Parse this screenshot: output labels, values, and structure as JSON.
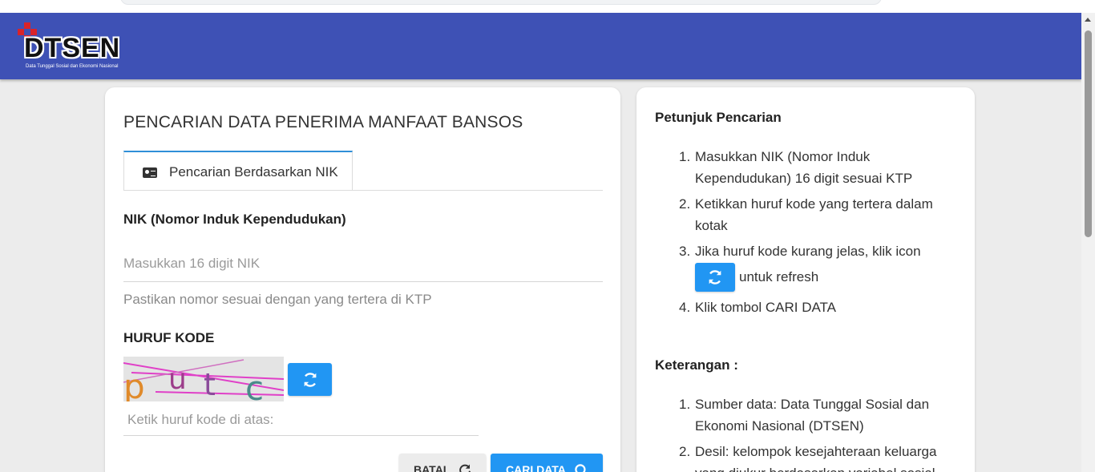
{
  "header": {
    "logo_text": "DTSEN",
    "logo_subtitle": "Data Tunggal Sosial dan Ekonomi Nasional"
  },
  "search_card": {
    "title": "PENCARIAN DATA PENERIMA MANFAAT BANSOS",
    "tab_label": "Pencarian Berdasarkan NIK",
    "nik_label": "NIK (Nomor Induk Kependudukan)",
    "nik_placeholder": "Masukkan 16 digit NIK",
    "nik_value": "",
    "nik_hint": "Pastikan nomor sesuai dengan yang tertera di KTP",
    "captcha_label": "HURUF KODE",
    "captcha_text": "putc",
    "captcha_placeholder": "Ketik huruf kode di atas:",
    "captcha_value": "",
    "cancel_label": "BATAL",
    "search_label": "CARI DATA"
  },
  "instructions": {
    "title": "Petunjuk Pencarian",
    "items": [
      "Masukkan NIK (Nomor Induk Kependudukan) 16 digit sesuai KTP",
      "Ketikkan huruf kode yang tertera dalam kotak",
      "Jika huruf kode kurang jelas, klik icon",
      "Klik tombol CARI DATA"
    ],
    "item3_suffix": "untuk refresh",
    "notes_title": "Keterangan :",
    "notes": [
      "Sumber data: Data Tunggal Sosial dan Ekonomi Nasional (DTSEN)",
      "Desil: kelompok kesejahteraan keluarga yang diukur berdasarkan variabel sosial"
    ]
  },
  "colors": {
    "header_bg": "#3e51b5",
    "accent_blue": "#2196f3",
    "logo_red": "#d8232a"
  }
}
